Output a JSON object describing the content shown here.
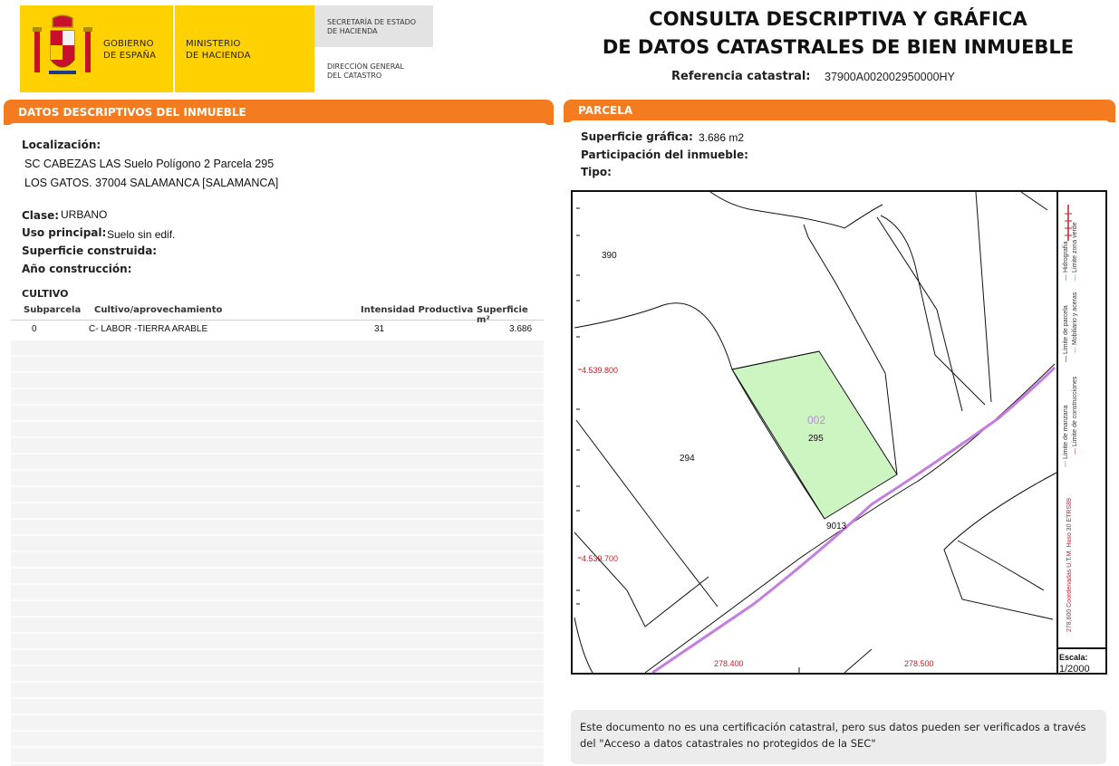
{
  "header": {
    "gobierno": "GOBIERNO\nDE ESPAÑA",
    "ministerio": "MINISTERIO\nDE HACIENDA",
    "secretaria": "SECRETARÍA DE ESTADO\nDE HACIENDA",
    "direccion": "DIRECCIÓN GENERAL\nDEL CATASTRO",
    "title_line1": "CONSULTA DESCRIPTIVA Y GRÁFICA",
    "title_line2": "DE DATOS CATASTRALES DE BIEN INMUEBLE",
    "ref_label": "Referencia catastral:",
    "ref_value": "37900A002002950000HY"
  },
  "descriptivos": {
    "section_title": "DATOS DESCRIPTIVOS DEL INMUEBLE",
    "localizacion_label": "Localización:",
    "localizacion_line1": "SC CABEZAS LAS  Suelo Polígono 2 Parcela 295",
    "localizacion_line2": "LOS GATOS. 37004 SALAMANCA [SALAMANCA]",
    "clase_label": "Clase:",
    "clase_value": "URBANO",
    "uso_label": "Uso principal:",
    "uso_value": "Suelo sin edif.",
    "superficie_label": "Superficie construida:",
    "anio_label": "Año construcción:"
  },
  "cultivo": {
    "title": "CULTIVO",
    "headers": [
      "Subparcela",
      "Cultivo/aprovechamiento",
      "Intensidad Productiva",
      "Superficie m²"
    ],
    "rows": [
      {
        "subparcela": "0",
        "cultivo": "C- LABOR -TIERRA ARABLE",
        "intensidad": "31",
        "superficie": "3.686"
      }
    ]
  },
  "parcela": {
    "section_title": "PARCELA",
    "superficie_label": "Superficie gráfica:",
    "superficie_value": "3.686 m2",
    "participacion_label": "Participación del inmueble:",
    "tipo_label": "Tipo:"
  },
  "map": {
    "labels": {
      "p390": "390",
      "p294": "294",
      "p002": "002",
      "p295": "295",
      "p9013": "9013",
      "y1": "4.539.800",
      "y2": "4.539.700",
      "x1": "278.400",
      "x2": "278.500"
    },
    "legend": {
      "hidrografia": "Hidrografía",
      "zona_verde": "Límite zona verde",
      "limite_parcela": "Límite de parcela",
      "mobiliario": "Mobiliario y aceras",
      "limite_manzana": "Límite de manzana",
      "limite_construcciones": "Límite de construcciones",
      "coordenadas": "278,600 Coordenadas U.T.M. Huso 30 ETRS89"
    },
    "scale_label": "Escala:",
    "scale_value": "1/2000",
    "colors": {
      "parcel_fill": "#ccf5c2",
      "road": "#c47ee0",
      "coords": "#c4202a"
    }
  },
  "note": {
    "text": "Este documento no es una certificación catastral, pero sus datos pueden ser verificados a través del \"Acceso a datos catastrales no protegidos de la SEC\""
  }
}
